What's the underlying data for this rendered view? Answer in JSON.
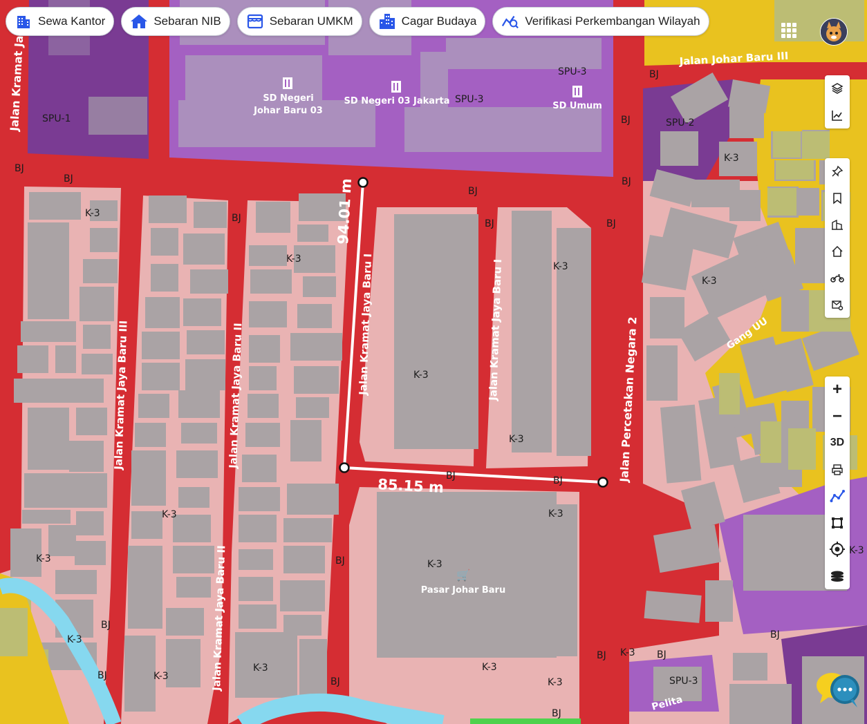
{
  "toolbar": {
    "items": [
      {
        "label": "Sewa Kantor",
        "icon": "building-icon"
      },
      {
        "label": "Sebaran NIB",
        "icon": "home-icon"
      },
      {
        "label": "Sebaran UMKM",
        "icon": "store-icon"
      },
      {
        "label": "Cagar Budaya",
        "icon": "city-icon"
      },
      {
        "label": "Verifikasi Perkembangan Wilayah",
        "icon": "chart-search-icon"
      }
    ]
  },
  "colors": {
    "road": "#d52d33",
    "k3_zone": "#e9b3b3",
    "spu_purple": "#a460c2",
    "spu_dark": "#7a3b93",
    "yellow_zone": "#e9c21f",
    "water": "#86d8ef",
    "building": "#aaa3a5",
    "accent_blue": "#2a57e8"
  },
  "map": {
    "street_labels": [
      "Jalan Kramat Ja",
      "Jalan Johar Baru III",
      "Jalan Kramat Jaya Baru III",
      "Jalan Kramat Jaya Baru II",
      "Jalan Kramat Jaya Baru I",
      "Jalan Percetakan Negara 2",
      "Gang UU",
      "Pelita"
    ],
    "pois": [
      {
        "name1": "SD Negeri",
        "name2": "Johar Baru 03"
      },
      {
        "name1": "SD Negeri 03 Jakarta",
        "name2": ""
      },
      {
        "name1": "SD Umum",
        "name2": ""
      },
      {
        "name1": "Pasar Johar Baru",
        "name2": ""
      }
    ],
    "zone_labels": {
      "bj": "BJ",
      "k3": "K-3",
      "spu1": "SPU-1",
      "spu2": "SPU-2",
      "spu3": "SPU-3",
      "k3_partial": "K-3",
      "truncated": "J"
    },
    "measurements": {
      "vertical": "94.01 m",
      "horizontal": "85.15 m"
    }
  },
  "right_panel": {
    "top": [
      "layers-icon",
      "line-chart-icon"
    ],
    "mid": [
      "pin-icon",
      "bookmark-icon",
      "building-outline-icon",
      "house-icon",
      "motorbike-icon",
      "mail-gear-icon"
    ],
    "bottom_labels": {
      "zoom_in": "+",
      "zoom_out": "−",
      "three_d": "3D"
    }
  }
}
